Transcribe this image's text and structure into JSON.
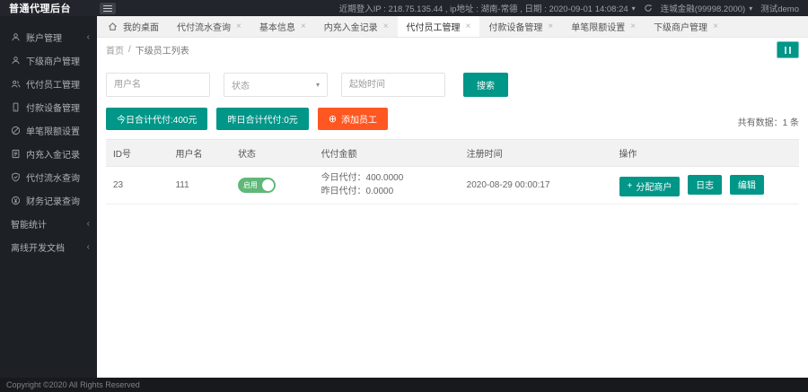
{
  "app": {
    "title": "普通代理后台",
    "copyright": "Copyright ©2020 All Rights Reserved"
  },
  "topbar": {
    "login_info": "近期登入IP : 218.75.135.44 , ip地址 : 湖南-常德 , 日期 : 2020-09-01 14:08:24",
    "merchant": "连城金融(99998.2000)",
    "username": "测试demo"
  },
  "icons": {
    "close": "×",
    "caret_down": "▾",
    "chevron": "‹",
    "plus_circle": "⊕",
    "plus": "+"
  },
  "sidebar": {
    "items": [
      {
        "label": "账户管理"
      },
      {
        "label": "下级商户管理"
      },
      {
        "label": "代付员工管理"
      },
      {
        "label": "付款设备管理"
      },
      {
        "label": "单笔限额设置"
      },
      {
        "label": "内充入金记录"
      },
      {
        "label": "代付流水查询"
      },
      {
        "label": "财务记录查询"
      },
      {
        "label": "智能统计"
      },
      {
        "label": "离线开发文档"
      }
    ]
  },
  "tabs": [
    {
      "label": "我的桌面"
    },
    {
      "label": "代付流水查询"
    },
    {
      "label": "基本信息"
    },
    {
      "label": "内充入金记录"
    },
    {
      "label": "代付员工管理"
    },
    {
      "label": "付款设备管理"
    },
    {
      "label": "单笔限额设置"
    },
    {
      "label": "下级商户管理"
    }
  ],
  "breadcrumb": {
    "home": "首页",
    "separator": "/",
    "current": "下级员工列表"
  },
  "filters": {
    "username_placeholder": "用户名",
    "status_placeholder": "状态",
    "start_time_placeholder": "起始时间",
    "search_label": "搜索"
  },
  "actions": {
    "today_total": "今日合计代付:400元",
    "yesterday_total": "昨日合计代付:0元",
    "add_employee": "添加员工"
  },
  "stats": {
    "total": "共有数据：1 条"
  },
  "table": {
    "headers": [
      "ID号",
      "用户名",
      "状态",
      "代付金额",
      "注册时间",
      "操作"
    ],
    "rows": [
      {
        "id": "23",
        "username": "111",
        "status": "启用",
        "amount_today": "今日代付：400.0000",
        "amount_yesterday": "昨日代付：0.0000",
        "register_time": "2020-08-29 00:00:17",
        "op_assign": "分配商户",
        "op_log": "日志",
        "op_edit": "编辑"
      }
    ]
  },
  "colors": {
    "accent": "#009688",
    "danger": "#ff5722",
    "toggle_on": "#5fb878"
  }
}
